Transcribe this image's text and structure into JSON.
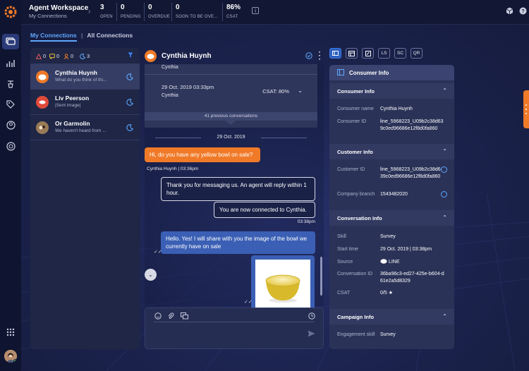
{
  "topbar": {
    "title": "Agent Workspace",
    "subtitle": "My Connections",
    "stats": [
      {
        "value": "3",
        "label": "OPEN"
      },
      {
        "value": "0",
        "label": "PENDING"
      },
      {
        "value": "0",
        "label": "OVERDUE"
      },
      {
        "value": "0",
        "label": "SOON TO BE OVE..."
      },
      {
        "value": "86%",
        "label": "CSAT"
      }
    ]
  },
  "tabs": {
    "my_connections": "My Connections",
    "all_connections": "All Connections"
  },
  "conv_list": {
    "counts": {
      "alerts": "0",
      "messages": "0",
      "users": "0",
      "away": "3"
    },
    "items": [
      {
        "name": "Cynthia Huynh",
        "preview": "What do you think of thi...",
        "avatar_color": "#f07a28"
      },
      {
        "name": "Liv Peerson",
        "preview": "|Sent image|",
        "avatar_color": "#e14b3a"
      },
      {
        "name": "Or Garmolin",
        "preview": "We haven't heard from ...",
        "avatar_color": "#9a7b57"
      }
    ]
  },
  "chat": {
    "header_name": "Cynthia Huynh",
    "history": {
      "top_author": "Cynthia",
      "date": "29 Oct. 2019 03:33pm",
      "author": "Cynthia",
      "csat": "CSAT: 80%",
      "previous": "41 previous conversations"
    },
    "date_divider": "29 Oct. 2019",
    "messages": [
      {
        "text": "Hi, do you have any yellow bowl on sale?",
        "meta": "Cynthia Huynh  | 03:36pm"
      },
      {
        "text": "Thank you for messaging us. An agent will reply within 1 hour."
      },
      {
        "text": "You are now connected to Cynthia.",
        "meta": "03:38pm"
      },
      {
        "text": "Hello. Yes! I will share with you the image of the bowl we currently have on sale"
      }
    ]
  },
  "tools": {
    "ls": "LS",
    "sc": "SC",
    "qr": "QR"
  },
  "info": {
    "title": "Consumer Info",
    "consumer": {
      "header": "Consumer Info",
      "name_label": "Consumer name",
      "name": "Cynthia Huynh",
      "id_label": "Consumer ID",
      "id": "line_5968223_U09b2c38d639c0ed96686e12f8d0fa860"
    },
    "customer": {
      "header": "Customer Info",
      "id_label": "Customer ID",
      "id": "line_5968223_U09b2c38d639c0ed96686e12f8d0fa860",
      "branch_label": "Company branch",
      "branch": "1543482020"
    },
    "conversation": {
      "header": "Conversation Info",
      "skill_label": "Skill",
      "skill": "Survey",
      "start_label": "Start time",
      "start": "29 Oct. 2019 | 03:38pm",
      "source_label": "Source",
      "source": "LINE",
      "conv_id_label": "Conversation ID",
      "conv_id": "36ba96c3-ed27-425e-b604-d61e2a5d8329",
      "csat_label": "CSAT",
      "csat": "0/5"
    },
    "campaign": {
      "header": "Campaign Info",
      "skill_label": "Engagement skill",
      "skill": "Survey"
    }
  },
  "colors": {
    "accent": "#3f86f5",
    "brand": "#f07a28",
    "panel": "#1f2646"
  }
}
